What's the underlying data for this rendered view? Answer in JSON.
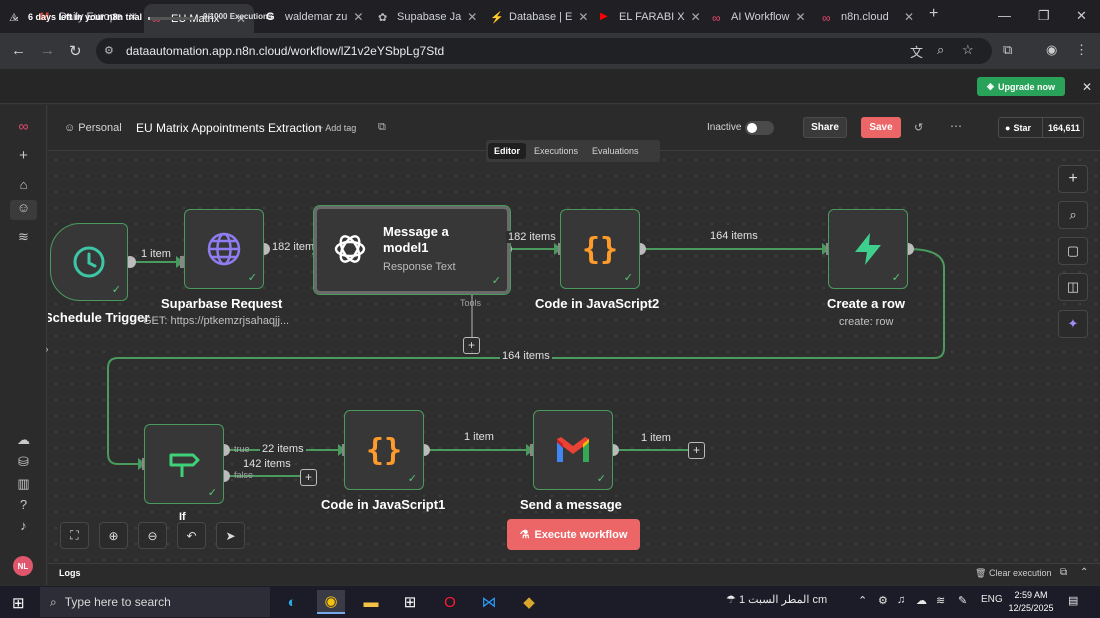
{
  "browser": {
    "tabs": [
      {
        "label": "Daily Europe",
        "fav_color": "#d44638",
        "fav": "M"
      },
      {
        "label": "EU Matrix",
        "fav_color": "#ea4b71",
        "fav": "∞"
      },
      {
        "label": "waldemar zu",
        "fav_color": "#ffffff",
        "fav": "G"
      },
      {
        "label": "Supabase Ja",
        "fav_color": "#bbbbbb",
        "fav": "✿"
      },
      {
        "label": "Database | E",
        "fav_color": "#3ecf8e",
        "fav": "⚡"
      },
      {
        "label": "EL FARABI X",
        "fav_color": "#ff0000",
        "fav": "▶"
      },
      {
        "label": "AI Workflow",
        "fav_color": "#ea4b71",
        "fav": "∞"
      },
      {
        "label": "n8n.cloud",
        "fav_color": "#ea4b71",
        "fav": "∞"
      }
    ],
    "url": "dataautomation.app.n8n.cloud/workflow/lZ1v2eYSbpLg7Std"
  },
  "trial": {
    "message": "6 days left in your n8n trial",
    "executions": "0/1000 Executions",
    "executions_used_fraction": 0.0,
    "upgrade_label": "Upgrade now"
  },
  "header": {
    "project": "Personal",
    "workflow_name": "EU Matrix Appointments Extraction",
    "add_tag": "+ Add tag",
    "status_label": "Inactive",
    "share_label": "Share",
    "save_label": "Save",
    "star_label": "Star",
    "star_count": "164,611"
  },
  "mode_tabs": [
    "Editor",
    "Executions",
    "Evaluations"
  ],
  "nodes": {
    "schedule": {
      "label": "Schedule Trigger"
    },
    "supabase_request": {
      "label": "Suparbase Request",
      "sub": "GET: https://ptkemzrjsahaqjj..."
    },
    "llm": {
      "title_line1": "Message a",
      "title_line2": "model1",
      "sub": "Response Text",
      "port_label": "Tools"
    },
    "code2": {
      "label": "Code in JavaScript2"
    },
    "create_row": {
      "label": "Create a row",
      "sub": "create: row"
    },
    "if": {
      "label": "If",
      "true_label": "true",
      "false_label": "false"
    },
    "code1": {
      "label": "Code in JavaScript1"
    },
    "gmail": {
      "label": "Send a message"
    }
  },
  "edges": {
    "sched_to_req": "1 item",
    "req_to_llm": "182 items",
    "llm_to_code2": "182 items",
    "code2_to_row": "164 items",
    "row_to_if": "164 items",
    "if_true": "22 items",
    "if_false": "142 items",
    "code1_to_gmail": "1 item",
    "gmail_out": "1 item"
  },
  "execute_label": "Execute workflow",
  "logs": {
    "label": "Logs",
    "clear_label": "Clear execution"
  },
  "taskbar": {
    "search_placeholder": "Type here to search",
    "weather": "المطر السبت 1 cm",
    "language": "ENG",
    "time": "2:59 AM",
    "date": "12/25/2025"
  },
  "user_initials": "NL"
}
